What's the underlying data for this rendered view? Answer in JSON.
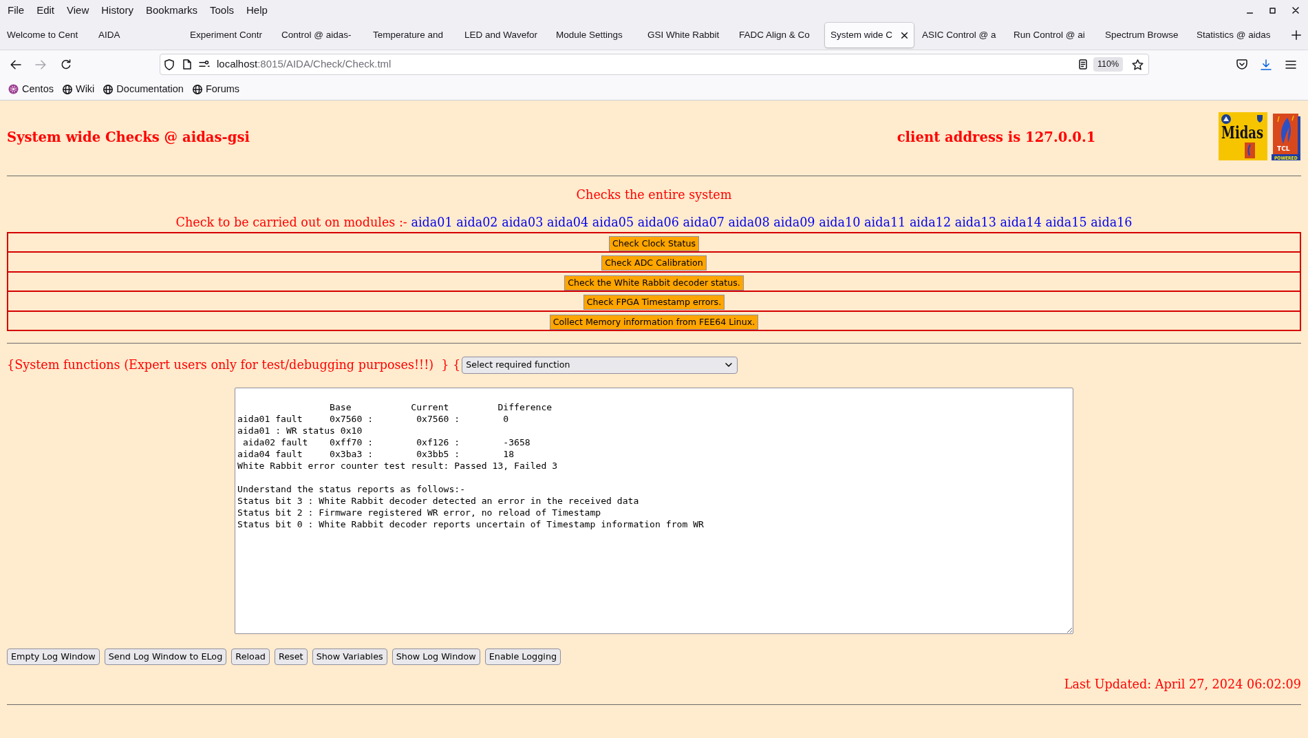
{
  "menu_bar": [
    {
      "label": "File"
    },
    {
      "label": "Edit"
    },
    {
      "label": "View"
    },
    {
      "label": "History"
    },
    {
      "label": "Bookmarks"
    },
    {
      "label": "Tools"
    },
    {
      "label": "Help"
    }
  ],
  "tabs": [
    {
      "label": "Welcome to Cent",
      "selected": false
    },
    {
      "label": "AIDA",
      "selected": false
    },
    {
      "label": "Experiment Contr",
      "selected": false
    },
    {
      "label": "Control @ aidas-",
      "selected": false
    },
    {
      "label": "Temperature and",
      "selected": false
    },
    {
      "label": "LED and Wavefor",
      "selected": false
    },
    {
      "label": "Module Settings",
      "selected": false
    },
    {
      "label": "GSI White Rabbit",
      "selected": false
    },
    {
      "label": "FADC Align & Co",
      "selected": false
    },
    {
      "label": "System wide C",
      "selected": true
    },
    {
      "label": "ASIC Control @ a",
      "selected": false
    },
    {
      "label": "Run Control @ ai",
      "selected": false
    },
    {
      "label": "Spectrum Browse",
      "selected": false
    },
    {
      "label": "Statistics @ aidas",
      "selected": false
    }
  ],
  "navigation": {
    "buttons": [
      {
        "kind": "back",
        "disabled": false
      },
      {
        "kind": "forward",
        "disabled": true
      },
      {
        "kind": "reload",
        "disabled": false
      }
    ],
    "url": {
      "host": "localhost",
      "path": ":8015/AIDA/Check/Check.tml"
    },
    "zoom": "110%"
  },
  "bookmarks": [
    {
      "label": "Centos",
      "kind": "favicon"
    },
    {
      "label": "Wiki",
      "kind": "default"
    },
    {
      "label": "Documentation",
      "kind": "default"
    },
    {
      "label": "Forums",
      "kind": "default"
    }
  ],
  "page": {
    "title": "System wide Checks @ aidas-gsi",
    "client_address": "client address is 127.0.0.1",
    "logos": [
      {
        "kind": "midas",
        "title": "Midas"
      },
      {
        "kind": "tcl",
        "title": "TCL",
        "caption": "POWERED"
      }
    ],
    "subtitle": "Checks the entire system",
    "modules_label": "Check to be carried out on modules :-",
    "modules": [
      "aida01",
      "aida02",
      "aida03",
      "aida04",
      "aida05",
      "aida06",
      "aida07",
      "aida08",
      "aida09",
      "aida10",
      "aida11",
      "aida12",
      "aida13",
      "aida14",
      "aida15",
      "aida16"
    ],
    "check_buttons": [
      "Check Clock Status",
      "Check ADC Calibration",
      "Check the White Rabbit decoder status.",
      "Check FPGA Timestamp errors.",
      "Collect Memory information from FEE64 Linux."
    ],
    "system_functions_label": "{System functions (Expert users only for test/debugging purposes!!!)  } {",
    "function_select": "Select required function",
    "log": "                 Base           Current         Difference\naida01 fault     0x7560 :        0x7560 :        0\naida01 : WR status 0x10\n aida02 fault    0xff70 :        0xf126 :        -3658\naida04 fault     0x3ba3 :        0x3bb5 :        18\nWhite Rabbit error counter test result: Passed 13, Failed 3\n\nUnderstand the status reports as follows:-\nStatus bit 3 : White Rabbit decoder detected an error in the received data\nStatus bit 2 : Firmware registered WR error, no reload of Timestamp\nStatus bit 0 : White Rabbit decoder reports uncertain of Timestamp information from WR",
    "buttons": [
      "Empty Log Window",
      "Send Log Window to ELog",
      "Reload",
      "Reset",
      "Show Variables",
      "Show Log Window",
      "Enable Logging"
    ],
    "last_updated": "Last Updated: April 27, 2024 06:02:09"
  }
}
